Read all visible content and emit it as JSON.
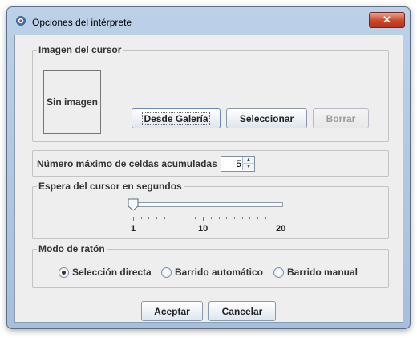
{
  "window": {
    "title": "Opciones del intérprete",
    "close_glyph": "✕"
  },
  "cursor_image": {
    "legend": "Imagen del cursor",
    "placeholder": "Sin imagen",
    "btn_gallery": "Desde Galería",
    "btn_select": "Seleccionar",
    "btn_clear": "Borrar"
  },
  "max_cells": {
    "label": "Número máximo de celdas acumuladas",
    "value": "5"
  },
  "cursor_wait": {
    "legend": "Espera del cursor en segundos",
    "slider": {
      "min": 1,
      "max": 20,
      "value": 1,
      "labels": [
        "1",
        "10",
        "20"
      ]
    }
  },
  "mouse_mode": {
    "legend": "Modo de ratón",
    "options": [
      {
        "label": "Selección directa",
        "checked": true
      },
      {
        "label": "Barrido automático",
        "checked": false
      },
      {
        "label": "Barrido manual",
        "checked": false
      }
    ]
  },
  "footer": {
    "accept": "Aceptar",
    "cancel": "Cancelar"
  },
  "colors": {
    "accent": "#6d89b5",
    "close": "#c9472b"
  }
}
